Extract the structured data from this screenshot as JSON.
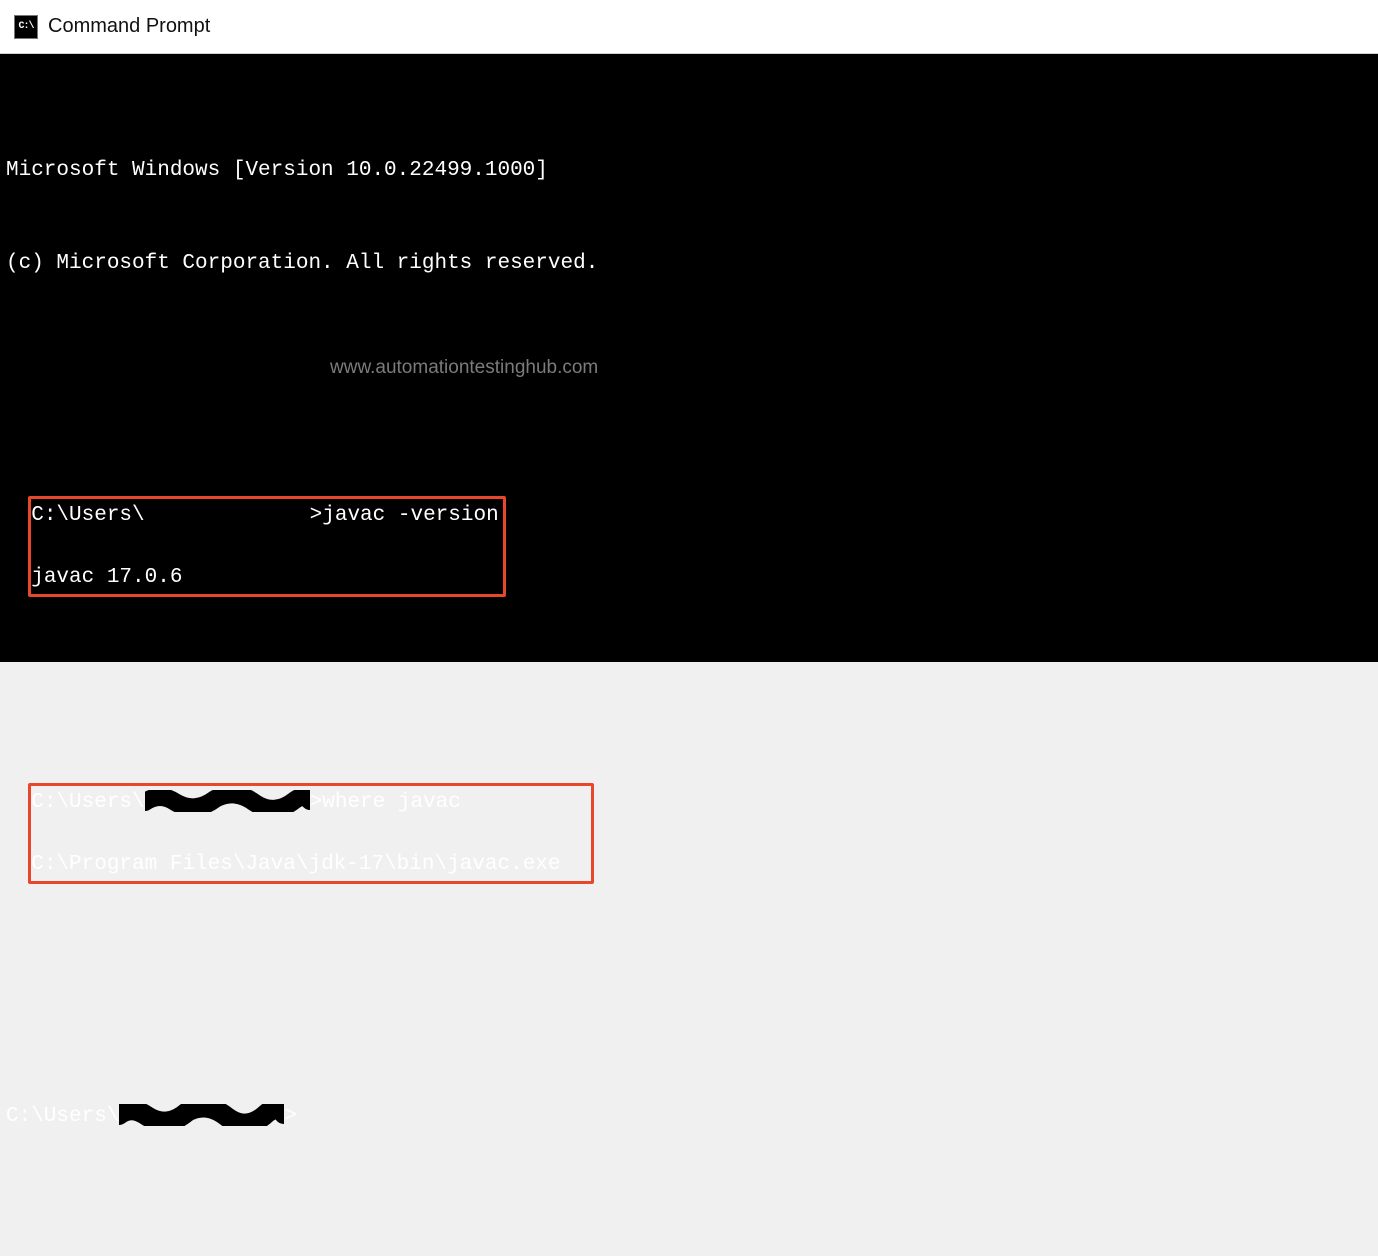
{
  "window": {
    "title": "Command Prompt"
  },
  "header": {
    "line1": "Microsoft Windows [Version 10.0.22499.1000]",
    "line2": "(c) Microsoft Corporation. All rights reserved."
  },
  "block1": {
    "prompt_prefix": "C:\\Users\\",
    "prompt_suffix": ">",
    "command": "javac -version",
    "output": "javac 17.0.6",
    "trailing_pad": "           "
  },
  "block2": {
    "prompt_prefix": "C:\\Users\\",
    "prompt_suffix": ">",
    "command": "where javac",
    "output": "C:\\Program Files\\Java\\jdk-17\\bin\\javac.exe",
    "trailing_pad": "          "
  },
  "idle_prompt": {
    "prompt_prefix": "C:\\Users\\",
    "prompt_suffix": ">"
  },
  "watermark": "www.automationtestinghub.com"
}
